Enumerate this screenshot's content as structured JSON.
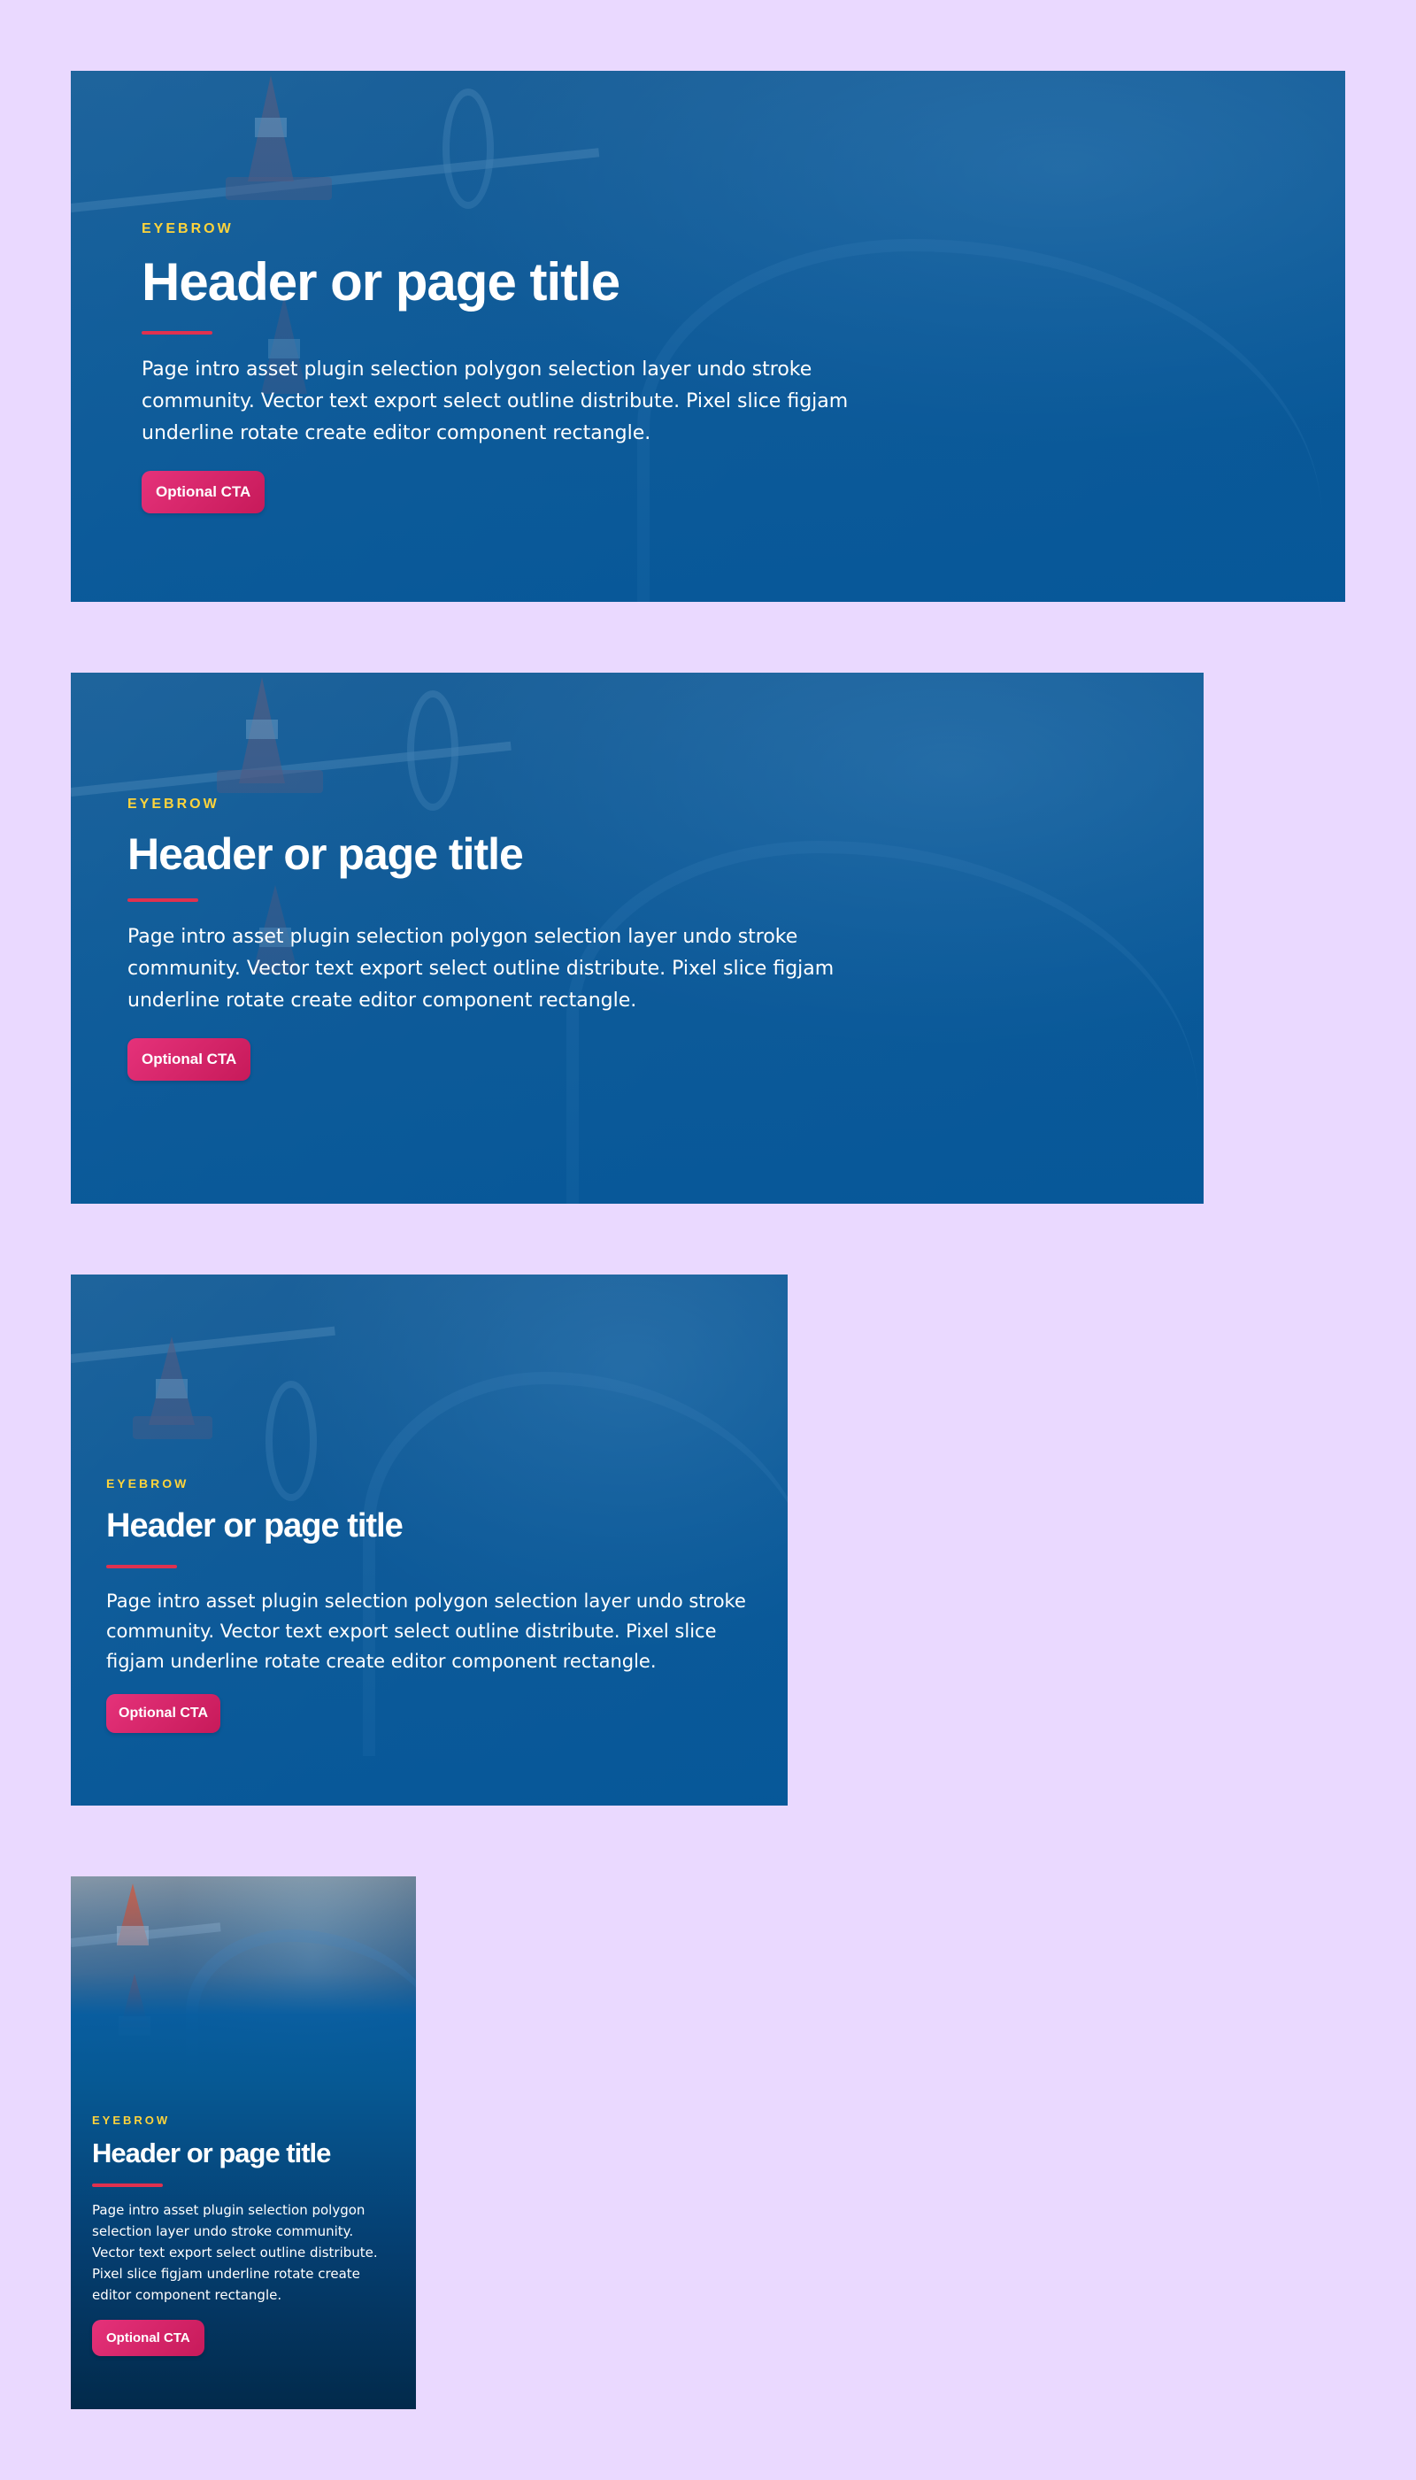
{
  "theme": {
    "page_background": "#ead9ff",
    "eyebrow_color": "#ffd43b",
    "rule_color": "#e0314f",
    "cta_color": "#d82468",
    "hero_blue": "#065994"
  },
  "heroes": [
    {
      "variant": "desktop-xl",
      "eyebrow": "EYEBROW",
      "title": "Header or page title",
      "intro": "Page intro asset plugin selection polygon selection layer undo stroke community. Vector text export select outline distribute. Pixel slice figjam underline rotate create editor component rectangle.",
      "cta": "Optional CTA",
      "image": "car-with-traffic-cones-photo"
    },
    {
      "variant": "desktop",
      "eyebrow": "EYEBROW",
      "title": "Header or page title",
      "intro": "Page intro asset plugin selection polygon selection layer undo stroke community. Vector text export select outline distribute. Pixel slice figjam underline rotate create editor component rectangle.",
      "cta": "Optional CTA",
      "image": "car-with-traffic-cones-photo"
    },
    {
      "variant": "tablet",
      "eyebrow": "EYEBROW",
      "title": "Header or page title",
      "intro": "Page intro asset plugin selection polygon selection layer undo stroke community. Vector text export select outline distribute. Pixel slice figjam underline rotate create editor component rectangle.",
      "cta": "Optional CTA",
      "image": "car-with-traffic-cones-photo"
    },
    {
      "variant": "mobile",
      "eyebrow": "EYEBROW",
      "title": "Header or page title",
      "intro": "Page intro asset plugin selection polygon selection layer undo stroke community. Vector text export select outline distribute. Pixel slice figjam underline rotate create editor component rectangle.",
      "cta": "Optional CTA",
      "image": "car-with-traffic-cones-photo"
    }
  ]
}
